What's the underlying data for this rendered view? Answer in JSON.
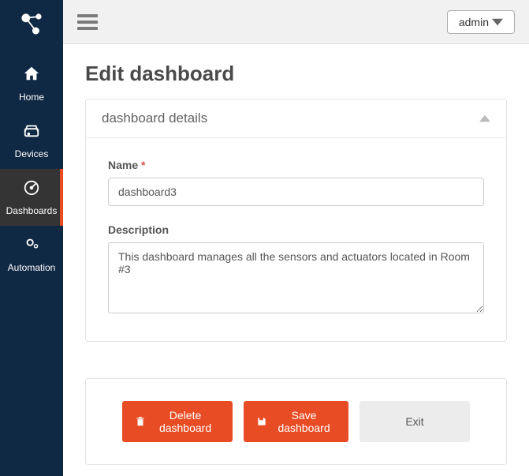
{
  "topbar": {
    "user_label": "admin"
  },
  "sidebar": {
    "items": [
      {
        "label": "Home"
      },
      {
        "label": "Devices"
      },
      {
        "label": "Dashboards"
      },
      {
        "label": "Automation"
      }
    ]
  },
  "page": {
    "title": "Edit dashboard"
  },
  "panel": {
    "title": "dashboard details",
    "name_label": "Name",
    "name_value": "dashboard3",
    "description_label": "Description",
    "description_value": "This dashboard manages all the sensors and actuators located in Room #3"
  },
  "actions": {
    "delete_label": "Delete dashboard",
    "save_label": "Save dashboard",
    "exit_label": "Exit"
  }
}
